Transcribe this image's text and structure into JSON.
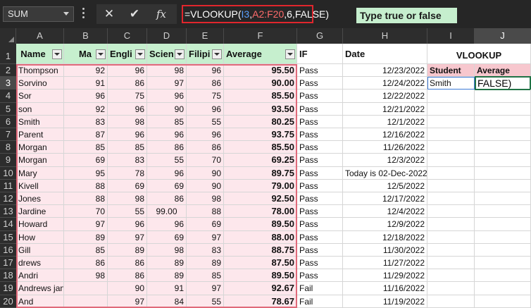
{
  "formula_bar": {
    "name_box": "SUM",
    "cancel_icon": "✕",
    "enter_icon": "✔",
    "fx_label": "fx",
    "formula_prefix": "=VLOOKUP(",
    "formula_ref1": "I3",
    "formula_comma1": ",",
    "formula_ref2": "A2:F20",
    "formula_suffix": ",6,FALSE)"
  },
  "hint_text": "Type true or false",
  "columns": [
    "A",
    "B",
    "C",
    "D",
    "E",
    "F",
    "G",
    "H",
    "I",
    "J"
  ],
  "rows": [
    "1",
    "2",
    "3",
    "4",
    "5",
    "6",
    "7",
    "8",
    "9",
    "10",
    "11",
    "12",
    "13",
    "14",
    "15",
    "16",
    "17",
    "18",
    "19",
    "20"
  ],
  "headers": {
    "name": "Name",
    "math": "Ma",
    "english": "Engli",
    "science": "Scien",
    "filipino": "Filipi",
    "average": "Average",
    "if": "IF",
    "date": "Date",
    "vlookup": "VLOOKUP",
    "student": "Student",
    "avg2": "Average"
  },
  "table": [
    [
      "Thompson",
      "92",
      "96",
      "98",
      "96",
      "95.50",
      "Pass",
      "12/23/2022"
    ],
    [
      "Sorvino",
      "91",
      "86",
      "97",
      "86",
      "90.00",
      "Pass",
      "12/24/2022"
    ],
    [
      "Sor",
      "96",
      "75",
      "96",
      "75",
      "85.50",
      "Pass",
      "12/22/2022"
    ],
    [
      "son",
      "92",
      "96",
      "90",
      "96",
      "93.50",
      "Pass",
      "12/21/2022"
    ],
    [
      "Smith",
      "83",
      "98",
      "85",
      "55",
      "80.25",
      "Pass",
      "12/1/2022"
    ],
    [
      "Parent",
      "87",
      "96",
      "96",
      "96",
      "93.75",
      "Pass",
      "12/16/2022"
    ],
    [
      "Morgan",
      "85",
      "85",
      "86",
      "86",
      "85.50",
      "Pass",
      "11/26/2022"
    ],
    [
      "Morgan",
      "69",
      "83",
      "55",
      "70",
      "69.25",
      "Pass",
      "12/3/2022"
    ],
    [
      "Mary",
      "95",
      "78",
      "96",
      "90",
      "89.75",
      "Pass",
      "Today is 02-Dec-2022"
    ],
    [
      "Kivell",
      "88",
      "69",
      "69",
      "90",
      "79.00",
      "Pass",
      "12/5/2022"
    ],
    [
      "Jones",
      "88",
      "98",
      "86",
      "98",
      "92.50",
      "Pass",
      "12/17/2022"
    ],
    [
      "Jardine",
      "70",
      "55",
      "99.00",
      "88",
      "78.00",
      "Pass",
      "12/4/2022"
    ],
    [
      "Howard",
      "97",
      "96",
      "96",
      "69",
      "89.50",
      "Pass",
      "12/9/2022"
    ],
    [
      "How",
      "89",
      "97",
      "69",
      "97",
      "88.00",
      "Pass",
      "12/18/2022"
    ],
    [
      "Gill",
      "85",
      "89",
      "98",
      "83",
      "88.75",
      "Pass",
      "11/30/2022"
    ],
    [
      "drews",
      "86",
      "86",
      "89",
      "89",
      "87.50",
      "Pass",
      "11/27/2022"
    ],
    [
      "Andri",
      "98",
      "86",
      "89",
      "85",
      "89.50",
      "Pass",
      "11/29/2022"
    ],
    [
      "Andrews jane",
      "",
      "90",
      "91",
      "97",
      "92.67",
      "Fail",
      "11/16/2022"
    ],
    [
      "And",
      "",
      "97",
      "84",
      "55",
      "78.67",
      "Fail",
      "11/19/2022"
    ]
  ],
  "lookup": {
    "student_value": "Smith",
    "average_edit": "FALSE)"
  },
  "colors": {
    "range_border": "#e06a7a",
    "ref_border": "#3c7ad6",
    "active_border": "#217346",
    "header_green": "#c6efce",
    "data_pink": "#fde7ec"
  }
}
